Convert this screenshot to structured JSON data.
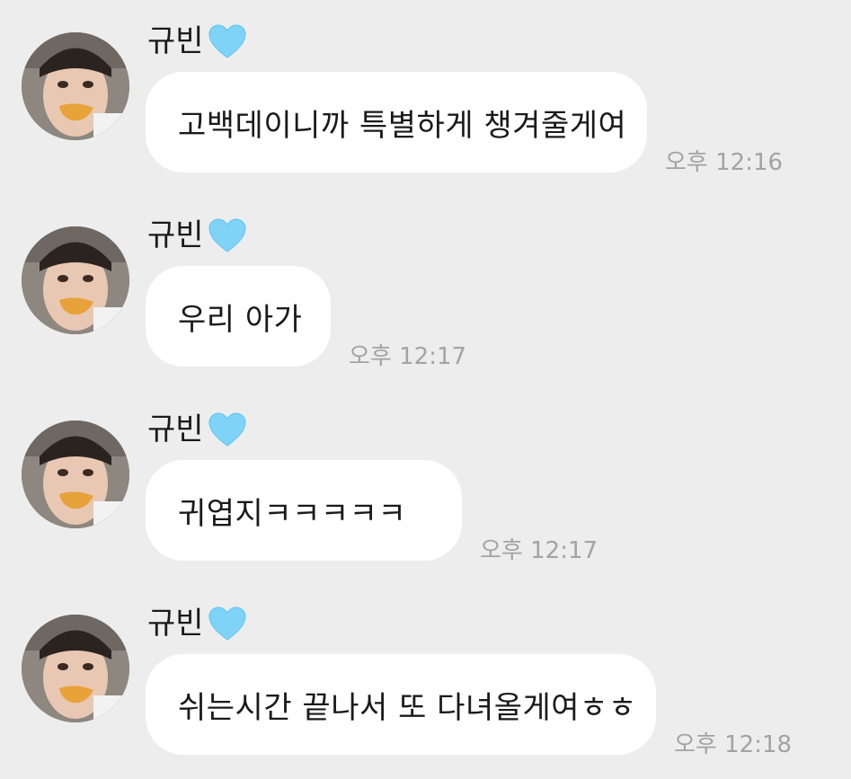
{
  "messages": [
    {
      "sender": "규빈",
      "text": "고백데이니까 특별하게 챙겨줄게여",
      "time": "오후 12:16"
    },
    {
      "sender": "규빈",
      "text": "우리 아가",
      "time": "오후 12:17"
    },
    {
      "sender": "규빈",
      "text": "귀엽지ㅋㅋㅋㅋㅋ",
      "time": "오후 12:17"
    },
    {
      "sender": "규빈",
      "text": "쉬는시간 끝나서 또 다녀올게여ㅎㅎ",
      "time": "오후 12:18"
    }
  ],
  "icons": {
    "avatar": "profile-photo",
    "name_emoji": "light-blue-heart-icon"
  },
  "colors": {
    "background": "#ededed",
    "bubble": "#ffffff",
    "text": "#1a1a1a",
    "timestamp": "#a3a3a3",
    "heart": "#7fd3f7"
  }
}
